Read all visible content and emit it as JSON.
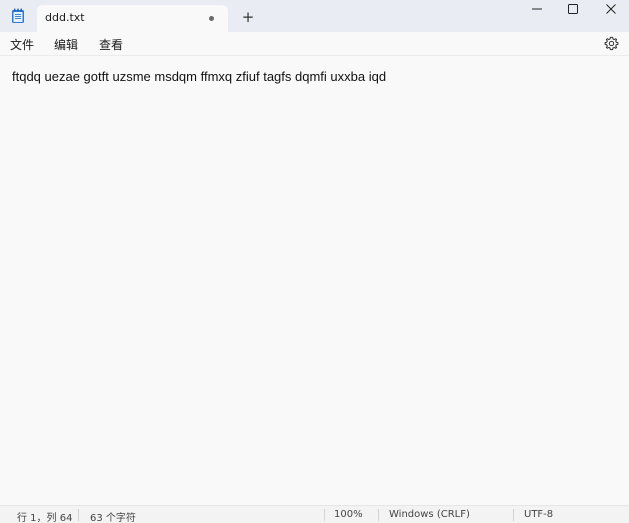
{
  "tab": {
    "title": "ddd.txt",
    "unsaved": true
  },
  "menu": {
    "file": "文件",
    "edit": "编辑",
    "view": "查看"
  },
  "editor": {
    "content": "ftqdq uezae gotft uzsme msdqm ffmxq zfiuf tagfs dqmfi uxxba iqd"
  },
  "status": {
    "position": "行 1，列 64",
    "char_count": "63 个字符",
    "zoom": "100%",
    "line_ending": "Windows (CRLF)",
    "encoding": "UTF-8"
  },
  "colors": {
    "titlebar": "#e9edf3",
    "background": "#f9f9f9"
  },
  "icons": [
    "notepad-icon",
    "new-tab-icon",
    "minimize-icon",
    "maximize-icon",
    "close-icon",
    "settings-icon"
  ]
}
